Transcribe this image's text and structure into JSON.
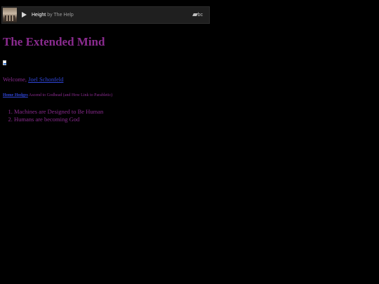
{
  "player": {
    "track_title": "Height",
    "track_by": "by The Help",
    "logo_text": "bc",
    "art_icon": "album-art",
    "play_icon": "play-icon"
  },
  "page": {
    "title": "The Extended Mind",
    "broken_image_icon": "broken-image-icon"
  },
  "welcome": {
    "prefix": "Welcome,",
    "user_link": "Joel Schonfeld"
  },
  "post": {
    "link_text": "Home Hodges",
    "rest": "Ascend to Godhead (and How Link to Parabletic)"
  },
  "chapters": [
    {
      "label": "Machines are Designed to Be Human"
    },
    {
      "label": "Humans are becoming God"
    }
  ],
  "colors": {
    "background": "#000000",
    "text": "#8a2b8f",
    "link": "#3046d8",
    "player_bg": "#1f1f1f"
  }
}
